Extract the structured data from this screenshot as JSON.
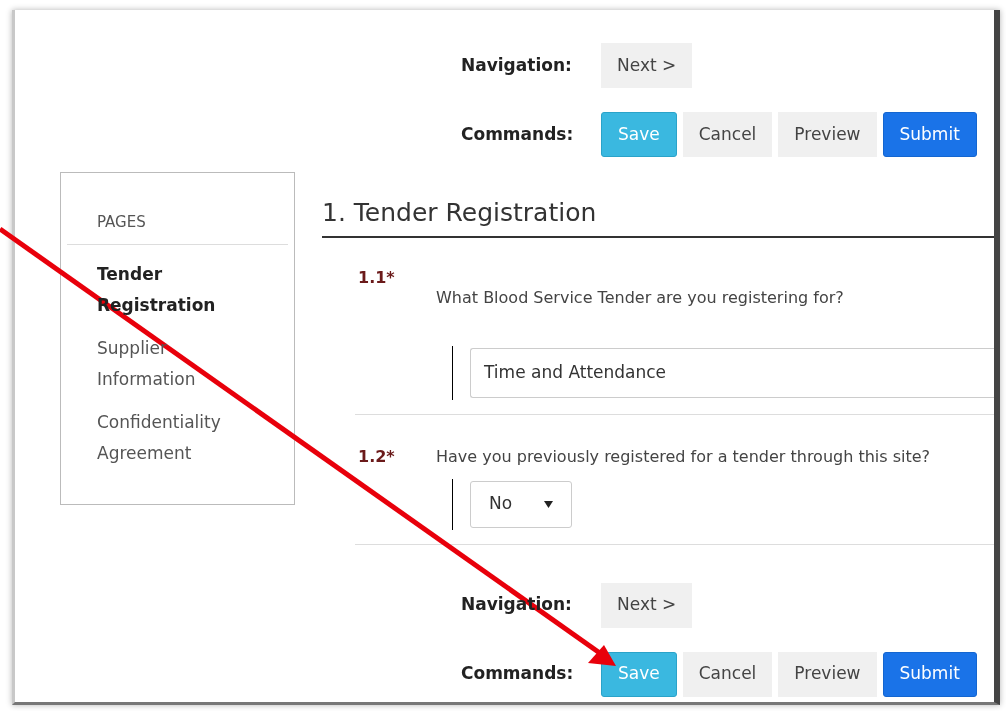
{
  "toolbars_top": [
    {
      "label": "Navigation:",
      "buttons": [
        {
          "label": "Next >",
          "kind": "default"
        }
      ]
    },
    {
      "label": "Commands:",
      "buttons": [
        {
          "label": "Save",
          "kind": "info"
        },
        {
          "label": "Cancel",
          "kind": "default"
        },
        {
          "label": "Preview",
          "kind": "default"
        },
        {
          "label": "Submit",
          "kind": "primary"
        }
      ]
    }
  ],
  "sidebar": {
    "heading": "PAGES",
    "items": [
      {
        "label": "Tender Registration",
        "selected": true
      },
      {
        "label": "Supplier Information",
        "selected": false
      },
      {
        "label": "Confidentiality Agreement",
        "selected": false
      }
    ]
  },
  "section_title": "1. Tender Registration",
  "questions": [
    {
      "number": "1.1*",
      "text": "What Blood Service Tender are you registering for?",
      "kind": "text",
      "value": "Time and Attendance"
    },
    {
      "number": "1.2*",
      "text": "Have you previously registered for a tender through this site?",
      "kind": "select",
      "value": "No"
    }
  ],
  "toolbars_bottom": [
    {
      "label": "Navigation:",
      "buttons": [
        {
          "label": "Next >",
          "kind": "default"
        }
      ]
    },
    {
      "label": "Commands:",
      "buttons": [
        {
          "label": "Save",
          "kind": "info"
        },
        {
          "label": "Cancel",
          "kind": "default"
        },
        {
          "label": "Preview",
          "kind": "default"
        },
        {
          "label": "Submit",
          "kind": "primary"
        }
      ]
    }
  ]
}
